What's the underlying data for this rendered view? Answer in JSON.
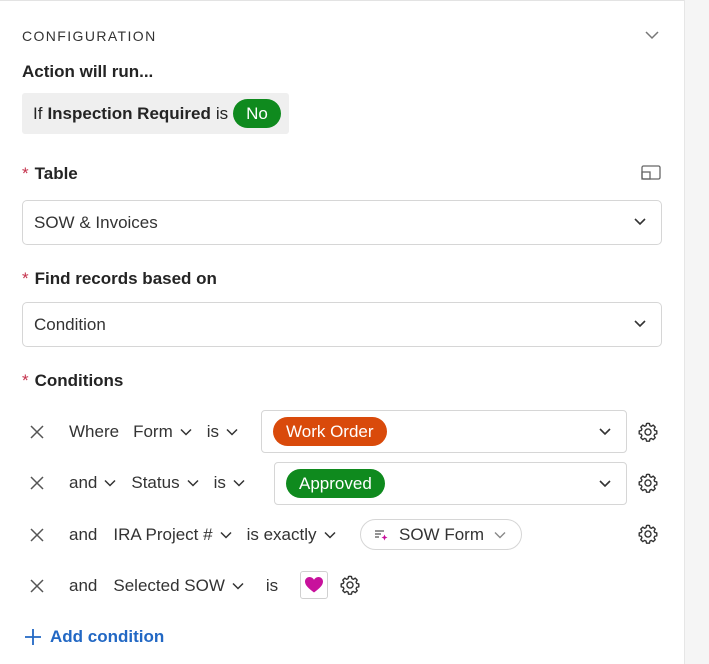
{
  "section": {
    "title": "CONFIGURATION"
  },
  "action": {
    "run_label": "Action will run..."
  },
  "condition_summary": {
    "prefix": "If",
    "field": "Inspection Required",
    "op": "is",
    "value": "No",
    "value_color": "#0f8a1e"
  },
  "table": {
    "label": "Table",
    "required_mark": "*",
    "value": "SOW & Invoices"
  },
  "find_records": {
    "label": "Find records based on",
    "required_mark": "*",
    "value": "Condition"
  },
  "conditions": {
    "label": "Conditions",
    "required_mark": "*",
    "rows": [
      {
        "conj": "Where",
        "field": "Form",
        "op": "is",
        "value": "Work Order",
        "value_color": "#d94a0b"
      },
      {
        "conj": "and",
        "field": "Status",
        "op": "is",
        "value": "Approved",
        "value_color": "#0f8a1e"
      },
      {
        "conj": "and",
        "field": "IRA Project #",
        "op": "is exactly",
        "value": "SOW Form"
      },
      {
        "conj": "and",
        "field": "Selected SOW",
        "op": "is",
        "value": "heart"
      }
    ],
    "add_label": "Add condition"
  },
  "icons": {
    "collapse": "chevron-down-icon",
    "expand": "expand-window-icon",
    "remove": "close-icon",
    "settings": "gear-icon",
    "formula": "formula-sparkle-icon",
    "add": "plus-icon",
    "heart": "heart-icon"
  },
  "colors": {
    "accent": "#2268c4",
    "required": "#c4314b",
    "heart": "#c8119c"
  }
}
